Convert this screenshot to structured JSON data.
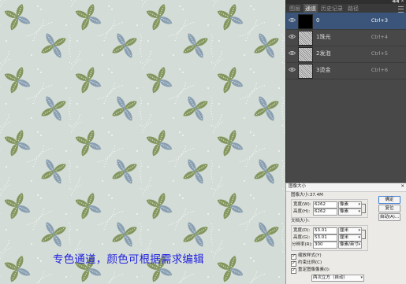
{
  "caption": "专色通道，颜色可根据需求编辑",
  "colors": {
    "background": "#d3dcd6",
    "leaf_olive": "#83965e",
    "leaf_blue": "#8aa0b2",
    "dots": "#ffffff",
    "caption": "#2323e0",
    "selection": "#3a5579"
  },
  "panel": {
    "tabs": [
      "图层",
      "通道",
      "历史记录",
      "路径"
    ],
    "active_tab": 1,
    "channels": [
      {
        "name": "0",
        "shortcut": "Ctrl+3",
        "selected": true,
        "thumb": "black"
      },
      {
        "name": "1珠光",
        "shortcut": "Ctrl+4",
        "selected": false,
        "thumb": "texture"
      },
      {
        "name": "2发泡",
        "shortcut": "Ctrl+5",
        "selected": false,
        "thumb": "texture"
      },
      {
        "name": "3烫金",
        "shortcut": "Ctrl+6",
        "selected": false,
        "thumb": "texture"
      }
    ]
  },
  "dialog": {
    "title": "图像大小",
    "image_size_label": "图像大小:37.4M",
    "pixel_dims": {
      "width_label": "宽度(W):",
      "width_value": "6262",
      "width_unit": "像素",
      "height_label": "高度(H):",
      "height_value": "6262",
      "height_unit": "像素"
    },
    "doc_size": {
      "section_label": "文档大小:",
      "width_label": "宽度(D):",
      "width_value": "53.01",
      "width_unit": "厘米",
      "height_label": "高度(G):",
      "height_value": "53.01",
      "height_unit": "厘米",
      "res_label": "分辨率(R):",
      "res_value": "300",
      "res_unit": "像素/英寸"
    },
    "buttons": {
      "ok": "确定",
      "reset": "复位",
      "auto": "自动(A)..."
    },
    "checkboxes": [
      {
        "label": "缩放样式(Y)",
        "checked": true
      },
      {
        "label": "约束比例(C)",
        "checked": true
      },
      {
        "label": "重定图像像素(I):",
        "checked": true
      }
    ],
    "resample_method": "两次立方（自动）"
  }
}
